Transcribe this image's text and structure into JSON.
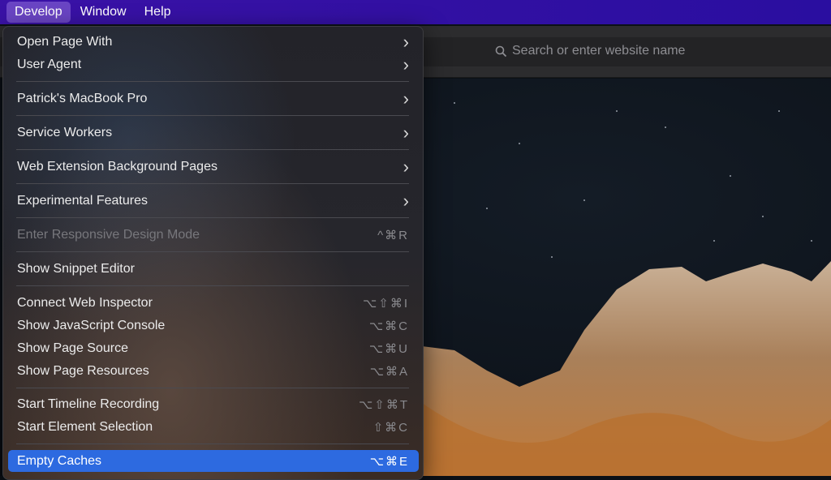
{
  "menubar": {
    "items": [
      "Develop",
      "Window",
      "Help"
    ]
  },
  "browser": {
    "search_placeholder": "Search or enter website name"
  },
  "menu": {
    "items": [
      {
        "label": "Open Page With",
        "submenu": true
      },
      {
        "label": "User Agent",
        "submenu": true
      },
      {
        "label": "Patrick's MacBook Pro",
        "submenu": true
      },
      {
        "label": "Service Workers",
        "submenu": true
      },
      {
        "label": "Web Extension Background Pages",
        "submenu": true
      },
      {
        "label": "Experimental Features",
        "submenu": true
      },
      {
        "label": "Enter Responsive Design Mode",
        "shortcut": "^⌘R",
        "disabled": true
      },
      {
        "label": "Show Snippet Editor"
      },
      {
        "label": "Connect Web Inspector",
        "shortcut": "⌥⇧⌘I"
      },
      {
        "label": "Show JavaScript Console",
        "shortcut": "⌥⌘C"
      },
      {
        "label": "Show Page Source",
        "shortcut": "⌥⌘U"
      },
      {
        "label": "Show Page Resources",
        "shortcut": "⌥⌘A"
      },
      {
        "label": "Start Timeline Recording",
        "shortcut": "⌥⇧⌘T"
      },
      {
        "label": "Start Element Selection",
        "shortcut": "⇧⌘C"
      },
      {
        "label": "Empty Caches",
        "shortcut": "⌥⌘E",
        "highlighted": true
      }
    ]
  },
  "colors": {
    "menubar": "#3a12a6",
    "highlight": "#2d6ae0"
  }
}
